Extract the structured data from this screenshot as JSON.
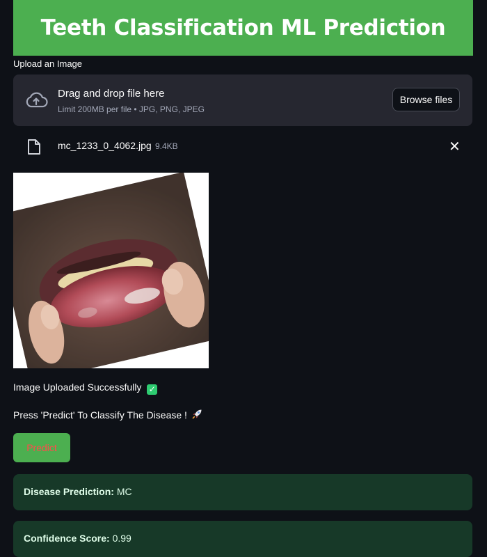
{
  "header": {
    "title": "Teeth Classification ML Prediction"
  },
  "uploader": {
    "label": "Upload an Image",
    "drop_title": "Drag and drop file here",
    "drop_subtitle": "Limit 200MB per file • JPG, PNG, JPEG",
    "browse_label": "Browse files",
    "file_name": "mc_1233_0_4062.jpg",
    "file_size": "9.4KB",
    "remove_symbol": "✕"
  },
  "status": {
    "uploaded_text": "Image Uploaded Successfully",
    "check_symbol": "✓",
    "instruction_text": "Press 'Predict' To Classify The Disease !"
  },
  "predict_button": {
    "label": "Predict"
  },
  "results": {
    "disease_label": "Disease Prediction:",
    "disease_value": "MC",
    "confidence_label": "Confidence Score:",
    "confidence_value": "0.99"
  },
  "colors": {
    "background": "#0e1117",
    "header_green": "#4caf50",
    "dropzone_bg": "#262730",
    "result_bg": "#173928",
    "predict_text": "#ff4b4b"
  },
  "icons": {
    "upload": "cloud-upload-icon",
    "file": "file-icon",
    "close": "close-icon",
    "success": "check-mark-icon",
    "rocket": "rocket-icon"
  }
}
